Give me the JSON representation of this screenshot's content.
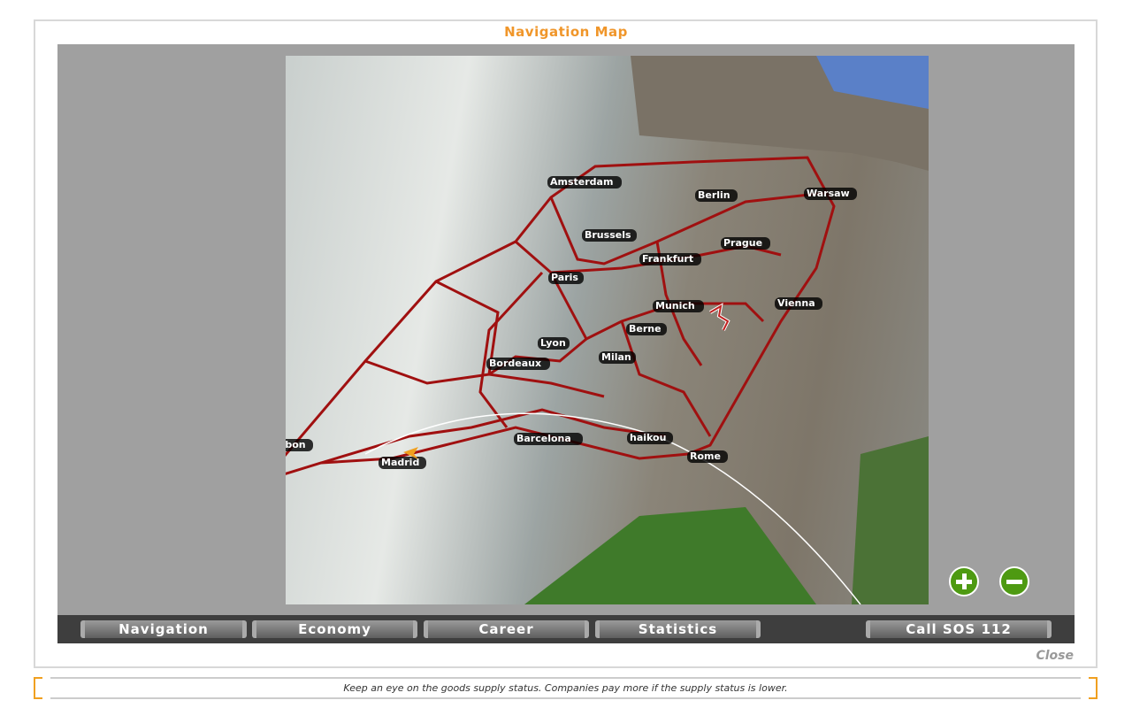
{
  "window": {
    "title": "Navigation Map",
    "close_label": "Close"
  },
  "map": {
    "cities": [
      "Amsterdam",
      "Berlin",
      "Warsaw",
      "Brussels",
      "Prague",
      "Frankfurt",
      "Paris",
      "Munich",
      "Vienna",
      "Berne",
      "Lyon",
      "Milan",
      "Bordeaux",
      "Barcelona",
      "haikou",
      "Rome",
      "Lisbon",
      "Madrid"
    ],
    "route_color": "#a01010",
    "player_marker_color": "#f0a020"
  },
  "zoom": {
    "in_icon": "plus-circle-icon",
    "out_icon": "minus-circle-icon"
  },
  "tabs": [
    {
      "label": "Navigation"
    },
    {
      "label": "Economy"
    },
    {
      "label": "Career"
    },
    {
      "label": "Statistics"
    }
  ],
  "sos_label": "Call SOS 112",
  "tip": "Keep an eye on the goods supply status. Companies pay more if the supply status is lower."
}
